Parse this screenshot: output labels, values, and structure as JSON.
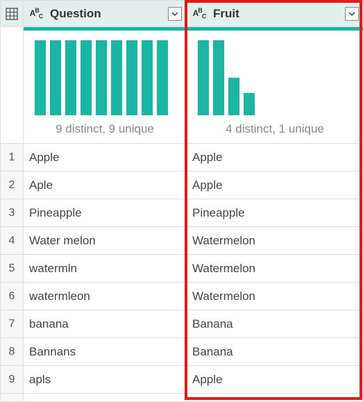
{
  "header": {
    "type_label": "ABC",
    "columns": [
      {
        "name": "Question"
      },
      {
        "name": "Fruit"
      }
    ]
  },
  "profiles": [
    {
      "stats": "9 distinct, 9 unique",
      "bars": [
        100,
        100,
        100,
        100,
        100,
        100,
        100,
        100,
        100
      ]
    },
    {
      "stats": "4 distinct, 1 unique",
      "bars": [
        100,
        100,
        50,
        30
      ]
    }
  ],
  "rows": [
    {
      "n": "1",
      "question": "Apple",
      "fruit": "Apple"
    },
    {
      "n": "2",
      "question": "Aple",
      "fruit": "Apple"
    },
    {
      "n": "3",
      "question": "Pineapple",
      "fruit": "Pineapple"
    },
    {
      "n": "4",
      "question": "Water melon",
      "fruit": "Watermelon"
    },
    {
      "n": "5",
      "question": "watermln",
      "fruit": "Watermelon"
    },
    {
      "n": "6",
      "question": "watermleon",
      "fruit": "Watermelon"
    },
    {
      "n": "7",
      "question": "banana",
      "fruit": "Banana"
    },
    {
      "n": "8",
      "question": "Bannans",
      "fruit": "Banana"
    },
    {
      "n": "9",
      "question": "apls",
      "fruit": "Apple"
    }
  ],
  "chart_data": [
    {
      "type": "bar",
      "title": "Question column value distribution",
      "categories": [
        "Apple",
        "Aple",
        "Pineapple",
        "Water melon",
        "watermln",
        "watermleon",
        "banana",
        "Bannans",
        "apls"
      ],
      "values": [
        1,
        1,
        1,
        1,
        1,
        1,
        1,
        1,
        1
      ],
      "stats": "9 distinct, 9 unique"
    },
    {
      "type": "bar",
      "title": "Fruit column value distribution",
      "categories": [
        "Apple",
        "Watermelon",
        "Banana",
        "Pineapple"
      ],
      "values": [
        3,
        3,
        2,
        1
      ],
      "stats": "4 distinct, 1 unique"
    }
  ]
}
